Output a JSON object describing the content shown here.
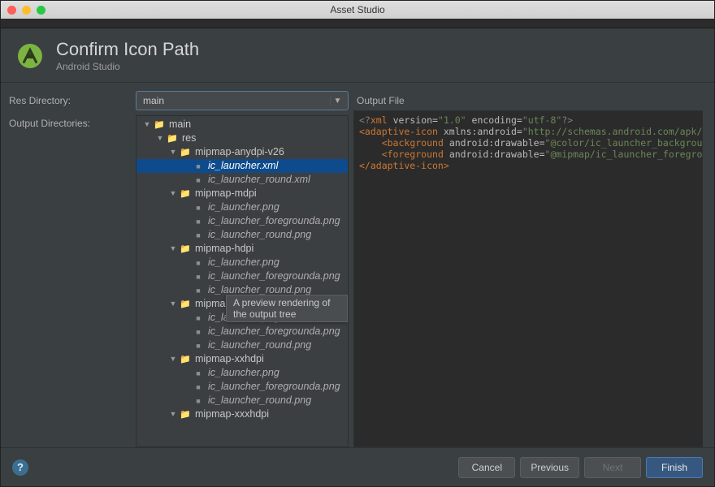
{
  "window": {
    "title": "Asset Studio"
  },
  "header": {
    "title": "Confirm Icon Path",
    "subtitle": "Android Studio"
  },
  "labels": {
    "res_dir": "Res Directory:",
    "out_dirs": "Output Directories:",
    "out_file": "Output File"
  },
  "res_directory": {
    "selected": "main"
  },
  "tooltip": "A preview rendering of the output tree",
  "tree": [
    {
      "d": 0,
      "exp": true,
      "t": "folder",
      "name": "main"
    },
    {
      "d": 1,
      "exp": true,
      "t": "folder",
      "name": "res"
    },
    {
      "d": 2,
      "exp": true,
      "t": "folder",
      "name": "mipmap-anydpi-v26"
    },
    {
      "d": 3,
      "t": "file",
      "name": "ic_launcher.xml",
      "sel": true
    },
    {
      "d": 3,
      "t": "file",
      "name": "ic_launcher_round.xml"
    },
    {
      "d": 2,
      "exp": true,
      "t": "folder",
      "name": "mipmap-mdpi"
    },
    {
      "d": 3,
      "t": "file",
      "name": "ic_launcher.png"
    },
    {
      "d": 3,
      "t": "file",
      "name": "ic_launcher_foregrounda.png"
    },
    {
      "d": 3,
      "t": "file",
      "name": "ic_launcher_round.png"
    },
    {
      "d": 2,
      "exp": true,
      "t": "folder",
      "name": "mipmap-hdpi"
    },
    {
      "d": 3,
      "t": "file",
      "name": "ic_launcher.png"
    },
    {
      "d": 3,
      "t": "file",
      "name": "ic_launcher_foregrounda.png"
    },
    {
      "d": 3,
      "t": "file",
      "name": "ic_launcher_round.png"
    },
    {
      "d": 2,
      "exp": true,
      "t": "folder",
      "name": "mipmap-xhdp"
    },
    {
      "d": 3,
      "t": "file",
      "name": "ic_launcher.png"
    },
    {
      "d": 3,
      "t": "file",
      "name": "ic_launcher_foregrounda.png"
    },
    {
      "d": 3,
      "t": "file",
      "name": "ic_launcher_round.png"
    },
    {
      "d": 2,
      "exp": true,
      "t": "folder",
      "name": "mipmap-xxhdpi"
    },
    {
      "d": 3,
      "t": "file",
      "name": "ic_launcher.png"
    },
    {
      "d": 3,
      "t": "file",
      "name": "ic_launcher_foregrounda.png"
    },
    {
      "d": 3,
      "t": "file",
      "name": "ic_launcher_round.png"
    },
    {
      "d": 2,
      "exp": true,
      "t": "folder",
      "name": "mipmap-xxxhdpi"
    }
  ],
  "xml": {
    "pi": "<?xml version=\"1.0\" encoding=\"utf-8\"?>",
    "root_open": "adaptive-icon",
    "xmlns_attr": "xmlns:android",
    "xmlns_val": "http://schemas.android.com/apk/res/andro",
    "bg_tag": "background",
    "bg_attr": "android:drawable",
    "bg_val": "@color/ic_launcher_background",
    "fg_tag": "foreground",
    "fg_attr": "android:drawable",
    "fg_val": "@mipmap/ic_launcher_foregrounda",
    "root_close": "adaptive-icon"
  },
  "buttons": {
    "cancel": "Cancel",
    "previous": "Previous",
    "next": "Next",
    "finish": "Finish"
  }
}
